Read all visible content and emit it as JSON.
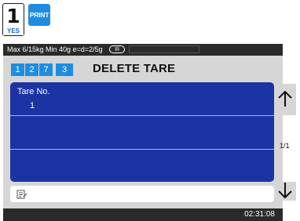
{
  "keys": {
    "yes_number": "1",
    "yes_label": "YES",
    "print_label": "PRINT"
  },
  "status": {
    "scale_spec": "Max 6/15kg Min 40g e=d=2/5g",
    "accuracy_class": "III"
  },
  "header": {
    "code_digits": [
      "1",
      "2",
      "7",
      "3"
    ],
    "title": "DELETE TARE"
  },
  "list": {
    "rows": [
      {
        "label": "Tare No.",
        "value": "1"
      },
      {
        "label": "",
        "value": ""
      },
      {
        "label": "",
        "value": ""
      }
    ]
  },
  "pager": {
    "indicator": "1/1"
  },
  "footer": {
    "time": "02:31:08"
  },
  "colors": {
    "accent_blue": "#1e8de0",
    "list_background": "#1c33a3",
    "bar_background": "#2a2a2a",
    "screen_background": "#d6d6d6"
  }
}
